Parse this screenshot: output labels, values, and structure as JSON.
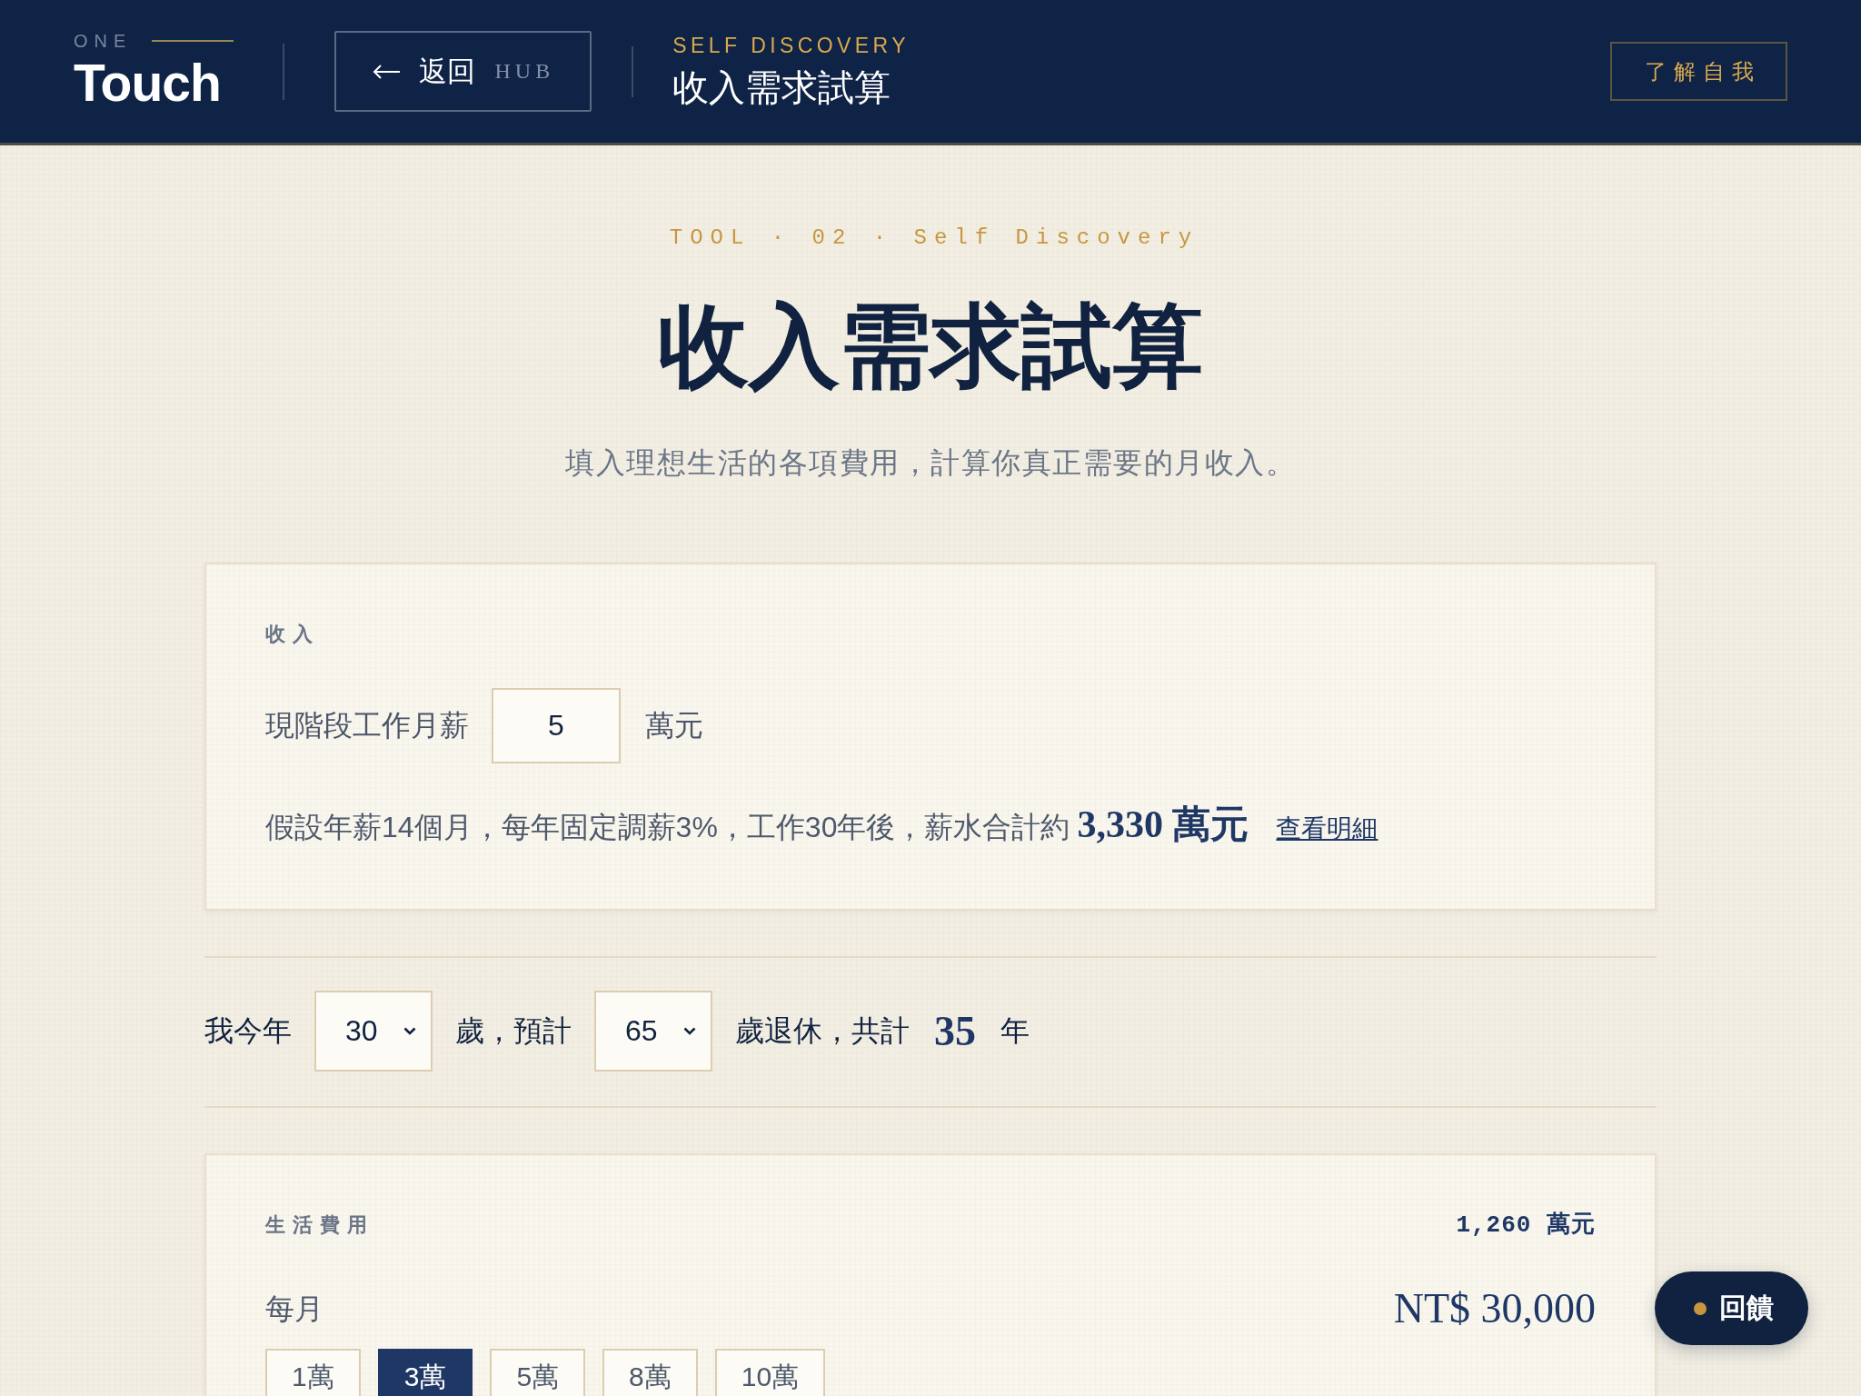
{
  "header": {
    "brand": {
      "overline": "ONE",
      "name": "Touch"
    },
    "back_button": {
      "label": "返回",
      "target": "HUB"
    },
    "section": {
      "eyebrow": "SELF DISCOVERY",
      "title": "收入需求試算"
    },
    "about_button": "了解自我"
  },
  "hero": {
    "eyebrow": "TOOL · 02 · Self Discovery",
    "title": "收入需求試算",
    "subtitle": "填入理想生活的各項費用，計算你真正需要的月收入。"
  },
  "income": {
    "heading": "收入",
    "salary_label": "現階段工作月薪",
    "salary_value": "5",
    "salary_unit": "萬元",
    "summary": "假設年薪14個月，每年固定調薪3%，工作30年後，薪水合計約",
    "summary_total": "3,330 萬元",
    "details_link": "查看明細"
  },
  "age": {
    "label_current": "我今年",
    "current_age": "30",
    "label_retire": "歲，預計",
    "retire_age": "65",
    "label_span": "歲退休，共計",
    "years": "35",
    "years_unit": "年"
  },
  "living_costs": {
    "heading": "生活費用",
    "total": "1,260 萬元",
    "period": "每月",
    "amount": "NT$ 30,000",
    "options": [
      {
        "label": "1萬",
        "selected": false
      },
      {
        "label": "3萬",
        "selected": true
      },
      {
        "label": "5萬",
        "selected": false
      },
      {
        "label": "8萬",
        "selected": false
      },
      {
        "label": "10萬",
        "selected": false
      }
    ]
  },
  "feedback_button": "回饋"
}
